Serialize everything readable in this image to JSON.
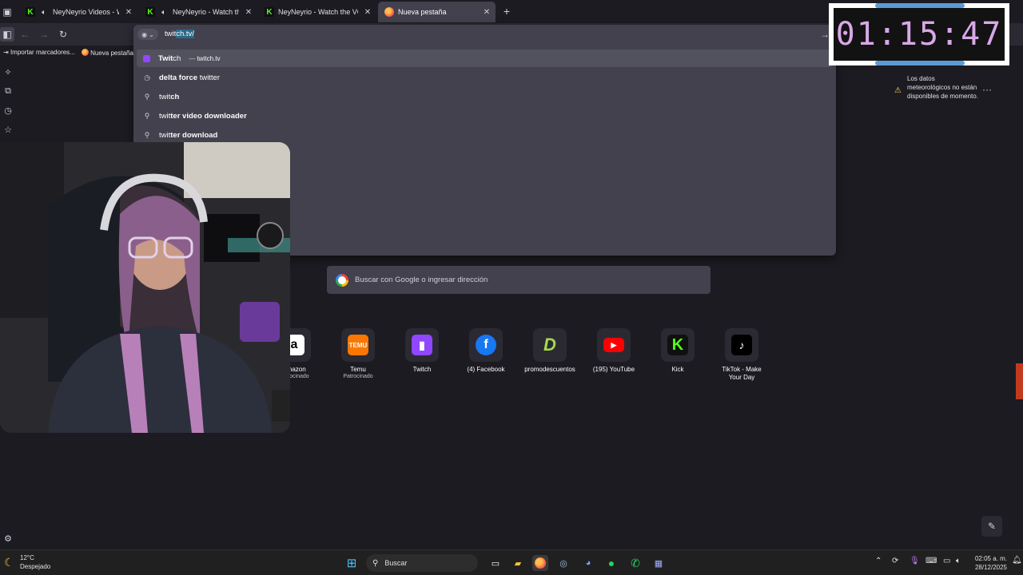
{
  "tabs": [
    {
      "title": "NeyNeyrio Videos - Watch",
      "icon": "kick-icon",
      "audio": true
    },
    {
      "title": "NeyNeyrio - Watch the VOD",
      "icon": "kick-icon",
      "audio": true
    },
    {
      "title": "NeyNeyrio - Watch the VOD on",
      "icon": "kick-icon",
      "audio": false
    },
    {
      "title": "Nueva pestaña",
      "icon": "firefox-icon",
      "audio": false,
      "active": true
    }
  ],
  "urlbar": {
    "typed": "twit",
    "completion": "ch.tv/"
  },
  "suggestions": [
    {
      "bold_prefix": "Twit",
      "rest": "ch",
      "separator": "—",
      "url": "twitch.tv",
      "icon": "twitch-icon"
    },
    {
      "bold_prefix": "delta force ",
      "rest": "twitter",
      "icon": "history-icon"
    },
    {
      "bold_prefix": "twit",
      "rest": "ch",
      "icon": "search-icon"
    },
    {
      "bold_prefix": "twit",
      "rest": "ter video downloader",
      "icon": "search-icon"
    },
    {
      "bold_prefix": "twit",
      "rest": "ter download",
      "icon": "search-icon"
    }
  ],
  "bookmarks": [
    "Importar marcadores...",
    "Nueva pestaña"
  ],
  "timer": "01:15:47",
  "weather": {
    "message": "Los datos meteorológicos no están disponibles de momento."
  },
  "search": {
    "placeholder": "Buscar con Google o ingresar dirección"
  },
  "shortcuts": [
    {
      "label": "Amazon",
      "sub": "Patrocinado",
      "color": "#ffffff"
    },
    {
      "label": "Temu",
      "sub": "Patrocinado",
      "color": "#fb7701"
    },
    {
      "label": "Twitch",
      "sub": "",
      "color": "#9146ff"
    },
    {
      "label": "(4) Facebook",
      "sub": "",
      "color": "#1877f2"
    },
    {
      "label": "promodescuentos",
      "sub": "",
      "color": "#2b2a33"
    },
    {
      "label": "(195) YouTube",
      "sub": "",
      "color": "#ff0000"
    },
    {
      "label": "Kick",
      "sub": "",
      "color": "#101010"
    },
    {
      "label": "TikTok - Make Your Day",
      "sub": "",
      "color": "#000000"
    }
  ],
  "taskbar": {
    "weather_temp": "12°C",
    "weather_desc": "Despejado",
    "search_label": "Buscar",
    "time": "02:05 a. m.",
    "date": "28/12/2025"
  }
}
